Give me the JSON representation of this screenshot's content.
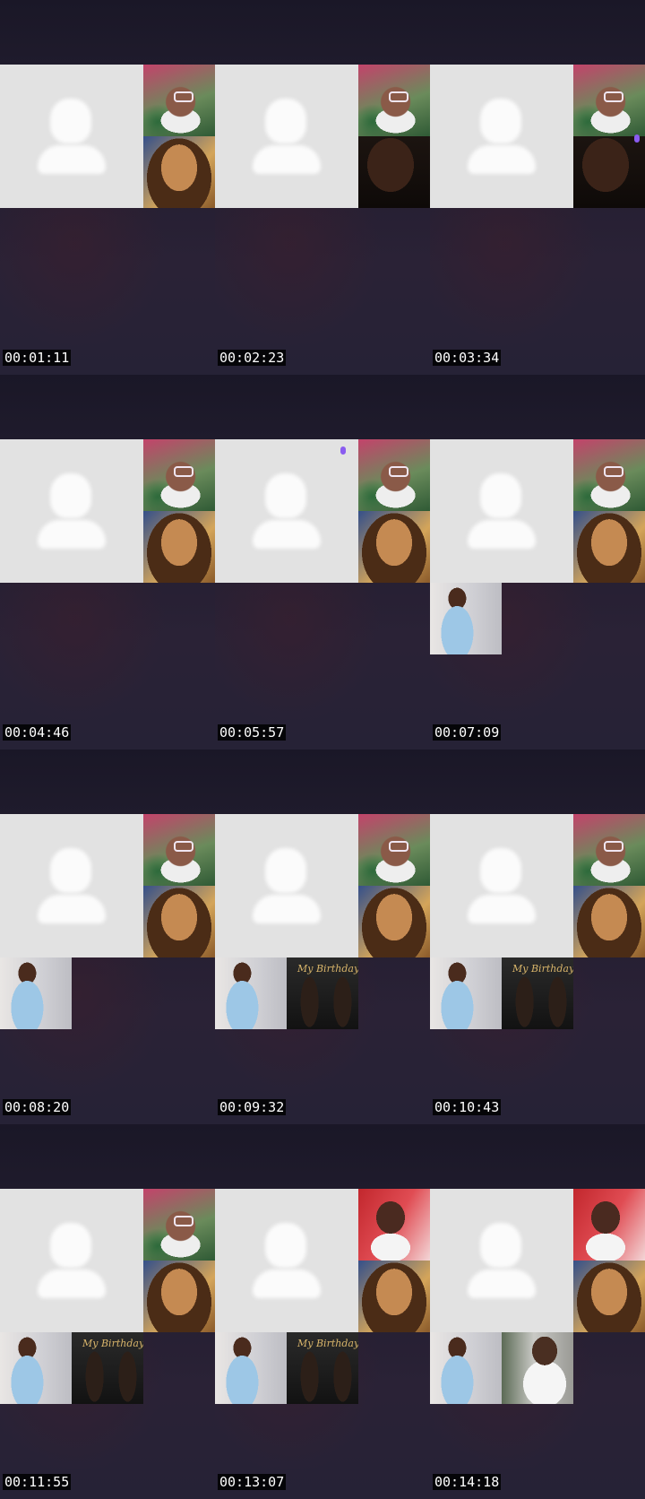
{
  "cells": [
    {
      "timestamp": "00:01:11",
      "tiles": [
        "pink-room",
        "glam"
      ]
    },
    {
      "timestamp": "00:02:23",
      "tiles": [
        "pink-room",
        "dark"
      ]
    },
    {
      "timestamp": "00:03:34",
      "tiles": [
        "pink-room",
        "dark"
      ],
      "mic": true
    },
    {
      "timestamp": "00:04:46",
      "tiles": [
        "pink-room",
        "glam"
      ]
    },
    {
      "timestamp": "00:05:57",
      "tiles": [
        "pink-room",
        "glam"
      ],
      "mic": true
    },
    {
      "timestamp": "00:07:09",
      "tiles": [
        "pink-room",
        "glam",
        "blue-dress"
      ]
    },
    {
      "timestamp": "00:08:20",
      "tiles": [
        "pink-room",
        "glam",
        "blue-dress"
      ]
    },
    {
      "timestamp": "00:09:32",
      "tiles": [
        "pink-room",
        "glam",
        "blue-dress",
        "birthday-flyer"
      ]
    },
    {
      "timestamp": "00:10:43",
      "tiles": [
        "pink-room",
        "glam",
        "blue-dress",
        "birthday-flyer"
      ]
    },
    {
      "timestamp": "00:11:55",
      "tiles": [
        "pink-room",
        "glam",
        "blue-dress",
        "birthday-flyer"
      ]
    },
    {
      "timestamp": "00:13:07",
      "tiles": [
        "red-wall",
        "glam",
        "blue-dress",
        "birthday-flyer"
      ]
    },
    {
      "timestamp": "00:14:18",
      "tiles": [
        "red-wall",
        "glam",
        "blue-dress",
        "car-selfie"
      ]
    }
  ],
  "flyer_text": "My Birthday",
  "colors": {
    "background": "#1e1b2b",
    "placeholder": "#e2e2e2",
    "avatar": "#fbfbfb",
    "mic": "#8a5cf0",
    "timestamp_bg": "#000000"
  },
  "icons": {
    "placeholder": "person-silhouette-icon",
    "mic": "microphone-icon"
  }
}
